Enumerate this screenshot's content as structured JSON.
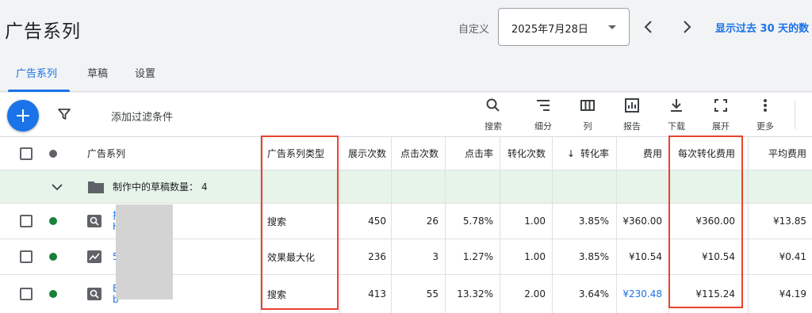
{
  "header": {
    "title": "广告系列",
    "date_label": "自定义",
    "date_value": "2025年7月28日",
    "show_link": "显示过去 30 天的数"
  },
  "tabs": [
    {
      "label": "广告系列",
      "active": true
    },
    {
      "label": "草稿",
      "active": false
    },
    {
      "label": "设置",
      "active": false
    }
  ],
  "toolbar": {
    "add_filter": "添加过滤条件",
    "tools": [
      {
        "label": "搜索",
        "icon": "search-icon"
      },
      {
        "label": "细分",
        "icon": "segment-icon"
      },
      {
        "label": "列",
        "icon": "columns-icon"
      },
      {
        "label": "报告",
        "icon": "report-icon"
      },
      {
        "label": "下载",
        "icon": "download-icon"
      },
      {
        "label": "展开",
        "icon": "expand-icon"
      },
      {
        "label": "更多",
        "icon": "more-vert-icon"
      }
    ]
  },
  "table": {
    "columns": [
      "广告系列",
      "广告系列类型",
      "展示次数",
      "点击次数",
      "点击率",
      "转化次数",
      "转化率",
      "费用",
      "每次转化费用",
      "平均费用"
    ],
    "sort_indicator": "↓",
    "draft_row": {
      "label": "制作中的草稿数量：",
      "count": "4"
    },
    "rows": [
      {
        "name_line1": "搜",
        "name_line2": "H",
        "type": "搜索",
        "impressions": "450",
        "clicks": "26",
        "ctr": "5.78%",
        "conversions": "1.00",
        "conv_rate": "3.85%",
        "cost": "¥360.00",
        "cost_per_conv": "¥360.00",
        "avg_cost": "¥13.85"
      },
      {
        "name_line1": "5",
        "name_line2": "",
        "type": "效果最大化",
        "impressions": "236",
        "clicks": "3",
        "ctr": "1.27%",
        "conversions": "1.00",
        "conv_rate": "3.85%",
        "cost": "¥10.54",
        "cost_per_conv": "¥10.54",
        "avg_cost": "¥0.41"
      },
      {
        "name_line1": "B",
        "name_line2": "b",
        "type": "搜索",
        "impressions": "413",
        "clicks": "55",
        "ctr": "13.32%",
        "conversions": "2.00",
        "conv_rate": "3.64%",
        "cost": "¥230.48",
        "cost_per_conv": "¥115.24",
        "avg_cost": "¥4.19"
      }
    ]
  },
  "colors": {
    "accent": "#1a73e8",
    "status_enabled": "#188038",
    "draft_row_bg": "#e6f4ea",
    "highlight_box": "#e8432e"
  }
}
